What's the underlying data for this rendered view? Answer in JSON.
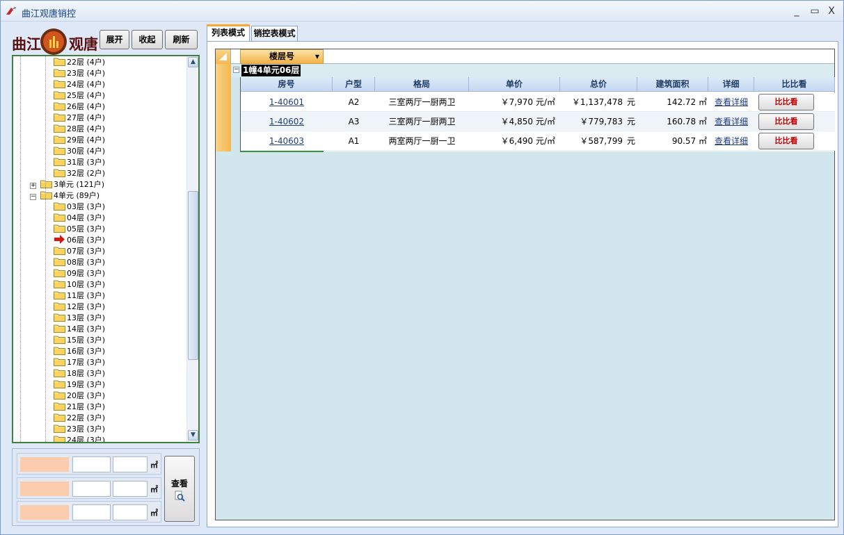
{
  "window": {
    "title": "曲江观唐销控",
    "controls": [
      "_",
      "▭",
      "X"
    ]
  },
  "logo": {
    "text_left": "曲江",
    "text_right": "观唐"
  },
  "toolbar": {
    "expand": "展开",
    "collapse": "收起",
    "refresh": "刷新"
  },
  "tree": {
    "rows": [
      {
        "label": "22层 (4户)",
        "level": 2
      },
      {
        "label": "23层 (4户)",
        "level": 2
      },
      {
        "label": "24层 (4户)",
        "level": 2
      },
      {
        "label": "25层 (4户)",
        "level": 2
      },
      {
        "label": "26层 (4户)",
        "level": 2
      },
      {
        "label": "27层 (4户)",
        "level": 2
      },
      {
        "label": "28层 (4户)",
        "level": 2
      },
      {
        "label": "29层 (4户)",
        "level": 2
      },
      {
        "label": "30层 (4户)",
        "level": 2
      },
      {
        "label": "31层 (3户)",
        "level": 2
      },
      {
        "label": "32层 (2户)",
        "level": 2
      },
      {
        "label": "3单元 (121户)",
        "level": 1,
        "expander": "+"
      },
      {
        "label": "4单元 (89户)",
        "level": 1,
        "expander": "-"
      },
      {
        "label": "03层 (3户)",
        "level": 2
      },
      {
        "label": "04层 (3户)",
        "level": 2
      },
      {
        "label": "05层 (3户)",
        "level": 2
      },
      {
        "label": "06层 (3户)",
        "level": 2,
        "selected": true
      },
      {
        "label": "07层 (3户)",
        "level": 2
      },
      {
        "label": "08层 (3户)",
        "level": 2
      },
      {
        "label": "09层 (3户)",
        "level": 2
      },
      {
        "label": "10层 (3户)",
        "level": 2
      },
      {
        "label": "11层 (3户)",
        "level": 2
      },
      {
        "label": "12层 (3户)",
        "level": 2
      },
      {
        "label": "13层 (3户)",
        "level": 2
      },
      {
        "label": "14层 (3户)",
        "level": 2
      },
      {
        "label": "15层 (3户)",
        "level": 2
      },
      {
        "label": "16层 (3户)",
        "level": 2
      },
      {
        "label": "17层 (3户)",
        "level": 2
      },
      {
        "label": "18层 (3户)",
        "level": 2
      },
      {
        "label": "19层 (3户)",
        "level": 2
      },
      {
        "label": "20层 (3户)",
        "level": 2
      },
      {
        "label": "21层 (3户)",
        "level": 2
      },
      {
        "label": "22层 (3户)",
        "level": 2
      },
      {
        "label": "23层 (3户)",
        "level": 2
      },
      {
        "label": "24层 (3户)",
        "level": 2
      }
    ]
  },
  "filters": {
    "unit": "㎡",
    "view_button": "查看"
  },
  "tabs": [
    {
      "label": "列表模式",
      "active": true
    },
    {
      "label": "销控表模式",
      "active": false
    }
  ],
  "grid": {
    "group_column": "楼层号",
    "group_value": "1幢4单元06层",
    "columns": [
      "房号",
      "户型",
      "格局",
      "单价",
      "总价",
      "建筑面积",
      "详细",
      "比比看"
    ],
    "rows": [
      {
        "room": "1-40601",
        "type": "A2",
        "layout": "三室两厅一厨两卫",
        "unit_price": "￥7,970",
        "unit_price_unit": "元/㎡",
        "total": "￥1,137,478",
        "total_unit": "元",
        "area": "142.72 ㎡",
        "detail": "查看详细",
        "compare": "比比看"
      },
      {
        "room": "1-40602",
        "type": "A3",
        "layout": "三室两厅一厨两卫",
        "unit_price": "￥4,850",
        "unit_price_unit": "元/㎡",
        "total": "￥779,783",
        "total_unit": "元",
        "area": "160.78 ㎡",
        "detail": "查看详细",
        "compare": "比比看"
      },
      {
        "room": "1-40603",
        "type": "A1",
        "layout": "两室两厅一厨一卫",
        "unit_price": "￥6,490",
        "unit_price_unit": "元/㎡",
        "total": "￥587,799",
        "total_unit": "元",
        "area": "90.57 ㎡",
        "detail": "查看详细",
        "compare": "比比看"
      }
    ]
  },
  "colors": {
    "accent": "#f7a833",
    "grid_bg": "#d1e7ed",
    "swatch": "#fcccaf",
    "title_text": "#15428b"
  }
}
